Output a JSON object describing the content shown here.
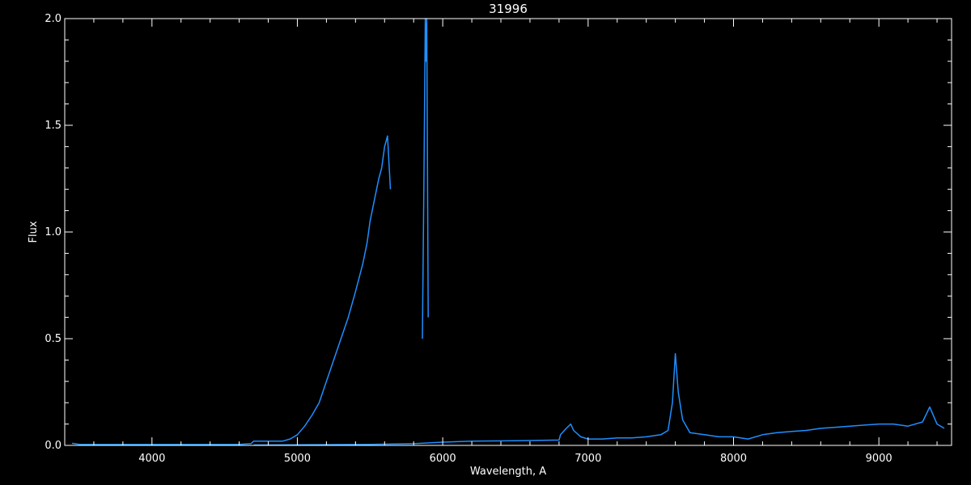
{
  "chart_data": {
    "type": "line",
    "title": "31996",
    "xlabel": "Wavelength, A",
    "ylabel": "Flux",
    "xlim": [
      3400,
      9500
    ],
    "ylim": [
      0,
      2.0
    ],
    "x_ticks": [
      4000,
      5000,
      6000,
      7000,
      8000,
      9000
    ],
    "x_tick_labels": [
      "4000",
      "5000",
      "6000",
      "7000",
      "8000",
      "9000"
    ],
    "y_ticks": [
      0,
      0.5,
      1.0,
      1.5,
      2.0
    ],
    "y_tick_labels": [
      "0.0",
      "0.5",
      "1.0",
      "1.5",
      "2.0"
    ],
    "grid": false,
    "legend": "none",
    "colors": {
      "background": "#000000",
      "axes": "#ffffff",
      "line": "#1f8fff"
    },
    "series": [
      {
        "x": [
          3450,
          3500,
          3600,
          3800,
          4000,
          4200,
          4400,
          4600,
          4680,
          4700,
          4800,
          4900,
          4950,
          5000,
          5050,
          5100,
          5150,
          5200,
          5250,
          5300,
          5350,
          5400,
          5450,
          5480,
          5500,
          5530,
          5560,
          5580,
          5600,
          5620,
          5640
        ],
        "y": [
          0.01,
          0.005,
          0.005,
          0.005,
          0.005,
          0.005,
          0.005,
          0.005,
          0.008,
          0.02,
          0.02,
          0.02,
          0.03,
          0.05,
          0.09,
          0.14,
          0.2,
          0.3,
          0.4,
          0.5,
          0.6,
          0.72,
          0.85,
          0.95,
          1.05,
          1.15,
          1.25,
          1.3,
          1.4,
          1.45,
          1.2
        ]
      },
      {
        "x": [
          5860,
          5870,
          5880,
          5885,
          5890,
          5900
        ],
        "y": [
          0.5,
          1.2,
          2.0,
          1.8,
          2.0,
          0.6
        ]
      },
      {
        "x": [
          4700,
          5000,
          5500,
          5800,
          6000,
          6200,
          6500,
          6800,
          6810,
          6850,
          6880,
          6900,
          6950,
          7000,
          7100,
          7200,
          7300,
          7400,
          7500,
          7550,
          7580,
          7600,
          7620,
          7650,
          7700,
          7800,
          7900,
          8000,
          8100,
          8200,
          8300,
          8400,
          8500,
          8600,
          8700,
          8800,
          8900,
          9000,
          9100,
          9200,
          9300,
          9350,
          9400,
          9450
        ],
        "y": [
          0.002,
          0.003,
          0.005,
          0.008,
          0.015,
          0.02,
          0.022,
          0.025,
          0.05,
          0.08,
          0.1,
          0.07,
          0.04,
          0.03,
          0.03,
          0.035,
          0.035,
          0.04,
          0.05,
          0.07,
          0.2,
          0.43,
          0.25,
          0.12,
          0.06,
          0.05,
          0.04,
          0.04,
          0.03,
          0.05,
          0.06,
          0.065,
          0.07,
          0.08,
          0.085,
          0.09,
          0.095,
          0.1,
          0.1,
          0.09,
          0.11,
          0.18,
          0.1,
          0.08
        ]
      }
    ]
  }
}
